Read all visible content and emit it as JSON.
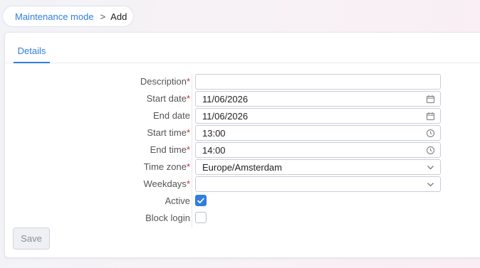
{
  "breadcrumb": {
    "parent": "Maintenance mode",
    "separator": ">",
    "current": "Add"
  },
  "tabs": [
    {
      "label": "Details",
      "active": true
    }
  ],
  "form": {
    "description": {
      "label": "Description",
      "required_mark": "*",
      "value": ""
    },
    "start_date": {
      "label": "Start date",
      "required_mark": "*",
      "value": "11/06/2026",
      "icon": "calendar-icon"
    },
    "end_date": {
      "label": "End date",
      "value": "11/06/2026",
      "icon": "calendar-icon"
    },
    "start_time": {
      "label": "Start time",
      "required_mark": "*",
      "value": "13:00",
      "icon": "clock-icon"
    },
    "end_time": {
      "label": "End time",
      "required_mark": "*",
      "value": "14:00",
      "icon": "clock-icon"
    },
    "time_zone": {
      "label": "Time zone",
      "required_mark": "*",
      "value": "Europe/Amsterdam",
      "icon": "chevron-down-icon"
    },
    "weekdays": {
      "label": "Weekdays",
      "required_mark": "*",
      "value": "",
      "icon": "chevron-down-icon"
    },
    "active": {
      "label": "Active",
      "checked": true
    },
    "block_login": {
      "label": "Block login",
      "checked": false
    }
  },
  "actions": {
    "save_label": "Save"
  },
  "colors": {
    "accent": "#2f7de0",
    "required": "#d12b2b"
  }
}
